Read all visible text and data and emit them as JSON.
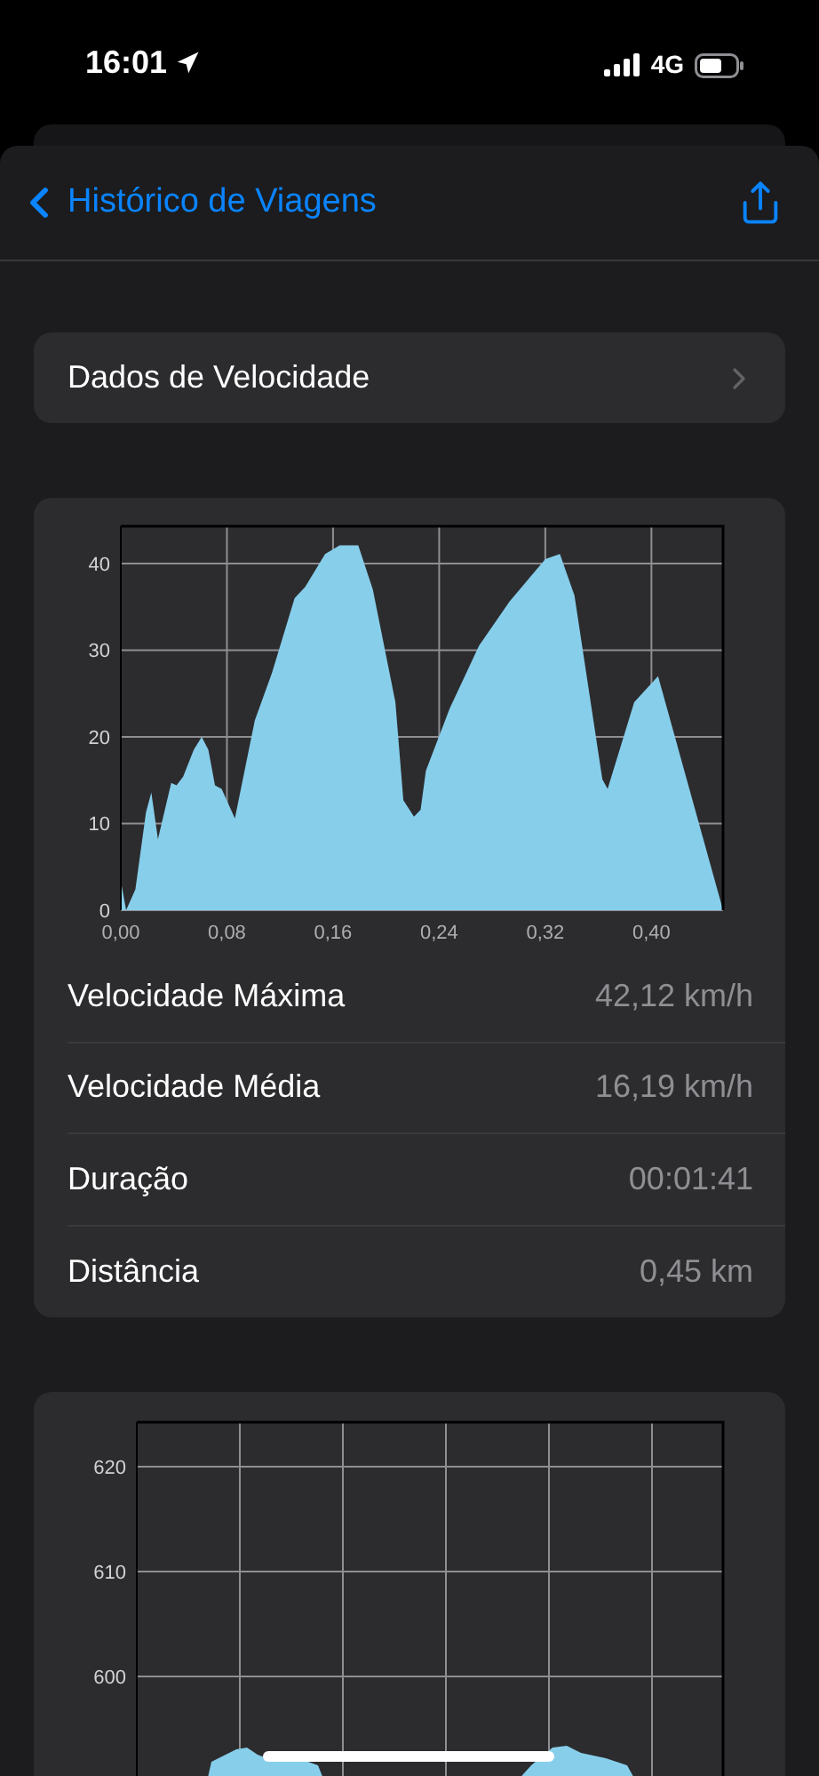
{
  "status_bar": {
    "time": "16:01",
    "network": "4G"
  },
  "nav": {
    "back_label": "Histórico de Viagens"
  },
  "section_link": {
    "label": "Dados de Velocidade"
  },
  "speed_chart": {
    "chart_data": {
      "type": "area",
      "xlim": [
        0,
        0.454
      ],
      "ylim": [
        0,
        44.3
      ],
      "xticks": [
        {
          "value": 0,
          "label": "0,00"
        },
        {
          "value": 0.08,
          "label": "0,08"
        },
        {
          "value": 0.16,
          "label": "0,16"
        },
        {
          "value": 0.24,
          "label": "0,24"
        },
        {
          "value": 0.32,
          "label": "0,32"
        },
        {
          "value": 0.4,
          "label": "0,40"
        }
      ],
      "yticks": [
        0,
        10,
        20,
        30,
        40
      ],
      "x": [
        0,
        0.004,
        0.011,
        0.019,
        0.023,
        0.028,
        0.038,
        0.042,
        0.047,
        0.055,
        0.061,
        0.066,
        0.071,
        0.076,
        0.086,
        0.101,
        0.114,
        0.131,
        0.139,
        0.154,
        0.165,
        0.179,
        0.19,
        0.207,
        0.213,
        0.221,
        0.226,
        0.23,
        0.248,
        0.27,
        0.293,
        0.32,
        0.331,
        0.342,
        0.363,
        0.367,
        0.387,
        0.405,
        0.454
      ],
      "grid": true,
      "series": [
        {
          "color": "#87ceeb",
          "values": [
            3.4,
            0,
            2.4,
            11.3,
            13.6,
            8.2,
            14.7,
            14.4,
            15.4,
            18.5,
            20,
            18.5,
            14.4,
            14,
            10.6,
            21.9,
            27.4,
            36,
            37.3,
            41.1,
            42.1,
            42.1,
            37,
            24,
            12.7,
            10.8,
            11.6,
            16.1,
            23.3,
            30.5,
            35.6,
            40.5,
            41.1,
            36.3,
            15.1,
            14,
            24,
            27,
            0
          ]
        }
      ]
    }
  },
  "stats": [
    {
      "label": "Velocidade Máxima",
      "value": "42,12 km/h"
    },
    {
      "label": "Velocidade Média",
      "value": "16,19 km/h"
    },
    {
      "label": "Duração",
      "value": "00:01:41"
    },
    {
      "label": "Distância",
      "value": "0,45 km"
    }
  ],
  "elevation_chart": {
    "y_labels": [
      "620",
      "610",
      "600"
    ]
  }
}
